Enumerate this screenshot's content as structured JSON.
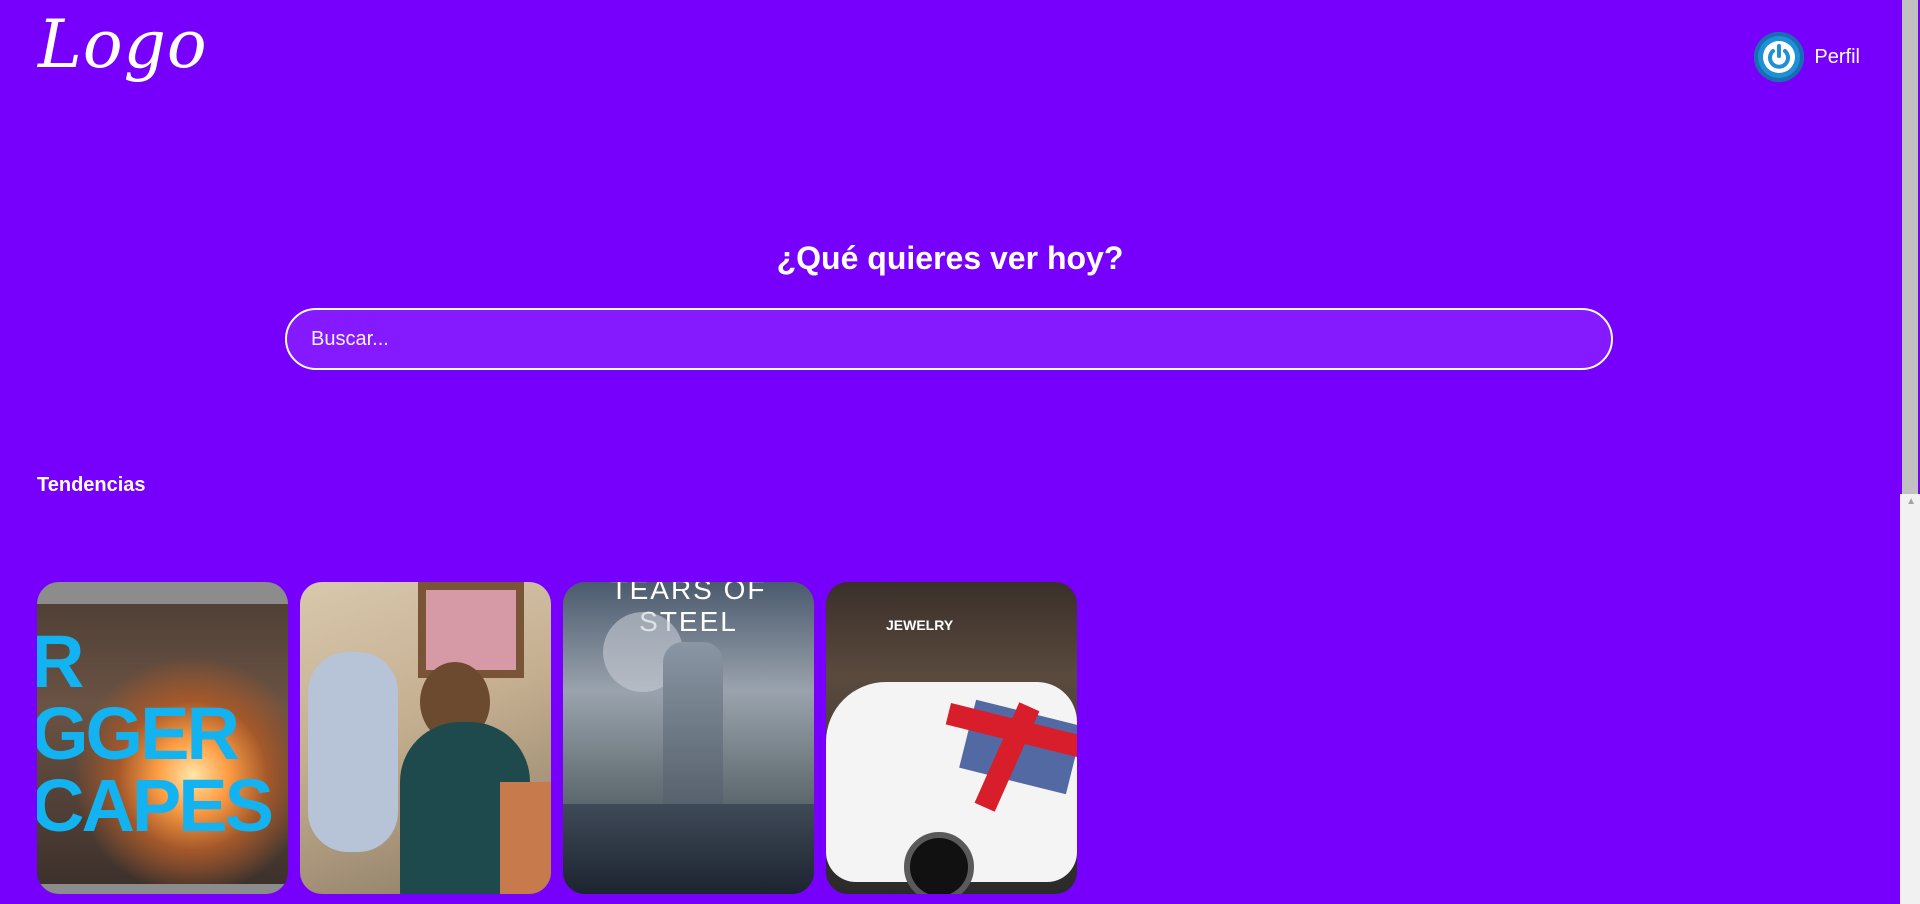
{
  "header": {
    "logo_text": "Logo",
    "profile_label": "Perfil",
    "profile_icon": "power-icon"
  },
  "hero": {
    "title": "¿Qué quieres ver hoy?",
    "search_placeholder": "Buscar..."
  },
  "trending": {
    "title": "Tendencias",
    "cards": [
      {
        "poster_text": "R\nGGER\nCAPES"
      },
      {
        "poster_text": ""
      },
      {
        "poster_text": "TEARS OF STEEL"
      },
      {
        "poster_text": "JEWELRY"
      }
    ]
  },
  "colors": {
    "background": "#7600fc",
    "search_background": "#8519ff",
    "accent": "#1f8fd6"
  }
}
